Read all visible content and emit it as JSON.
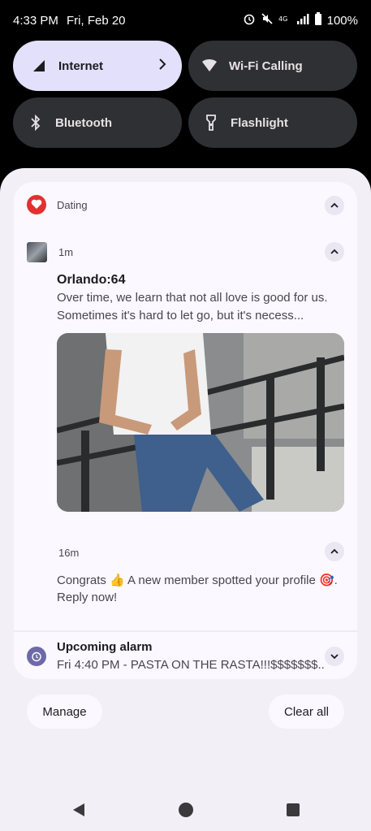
{
  "status_bar": {
    "time": "4:33 PM",
    "date": "Fri, Feb 20",
    "battery": "100%"
  },
  "quick_settings": {
    "tiles": [
      {
        "label": "Internet"
      },
      {
        "label": "Wi-Fi Calling"
      },
      {
        "label": "Bluetooth"
      },
      {
        "label": "Flashlight"
      }
    ]
  },
  "notifications": {
    "group_app": "Dating",
    "items": [
      {
        "time": "1m",
        "title": "Orlando:64",
        "text": "Over time, we learn that not all love is good for us.",
        "text2": "Sometimes it's hard to let go, but it's necess..."
      },
      {
        "time": "16m",
        "text": "Congrats 👍 A new member spotted your profile 🎯.",
        "text2": "Reply now!"
      }
    ],
    "alarm": {
      "title": "Upcoming alarm",
      "text": "Fri 4:40 PM - PASTA ON THE RASTA!!!$$$$$$$.."
    }
  },
  "actions": {
    "manage": "Manage",
    "clear_all": "Clear all"
  },
  "colors": {
    "accent": "#e3e0fb",
    "dating_red": "#e03131",
    "alarm_purple": "#6e6aa8"
  }
}
